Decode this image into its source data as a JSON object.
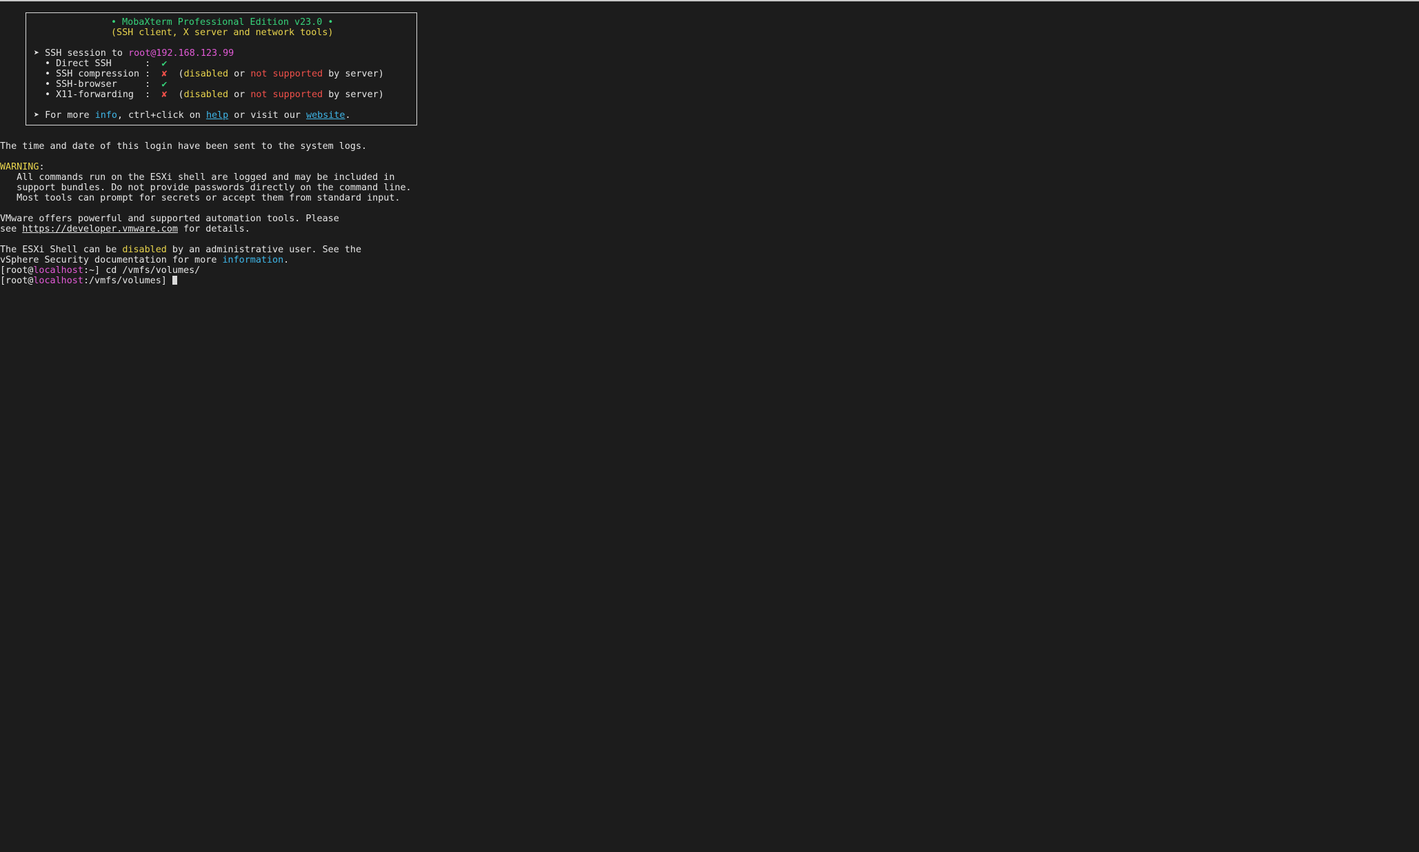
{
  "banner": {
    "title_bullet_left": "•",
    "title": "MobaXterm Professional Edition v23.0",
    "title_bullet_right": "•",
    "subtitle": "(SSH client, X server and network tools)",
    "session_arrow": "➤",
    "session_prefix": "SSH session to",
    "session_target": "root@192.168.123.99",
    "items": [
      {
        "bullet": "•",
        "label": "Direct SSH      :",
        "mark": "✔",
        "status": "ok"
      },
      {
        "bullet": "•",
        "label": "SSH compression :",
        "mark": "✘",
        "status": "fail",
        "note_open": "(",
        "note_disabled": "disabled",
        "note_or": "or",
        "note_not_supported": "not supported",
        "note_by": "by server)"
      },
      {
        "bullet": "•",
        "label": "SSH-browser     :",
        "mark": "✔",
        "status": "ok"
      },
      {
        "bullet": "•",
        "label": "X11-forwarding  :",
        "mark": "✘",
        "status": "fail",
        "note_open": "(",
        "note_disabled": "disabled",
        "note_or": "or",
        "note_not_supported": "not supported",
        "note_by": "by server)"
      }
    ],
    "more_arrow": "➤",
    "more_prefix": "For more",
    "more_info": "info",
    "more_mid": ", ctrl+click on",
    "more_help": "help",
    "more_visit": "or visit our",
    "more_website": "website",
    "more_end": "."
  },
  "output": {
    "login_notice": "The time and date of this login have been sent to the system logs.",
    "warning_label": "WARNING",
    "warning_colon": ":",
    "warning_lines": [
      "   All commands run on the ESXi shell are logged and may be included in",
      "   support bundles. Do not provide passwords directly on the command line.",
      "   Most tools can prompt for secrets or accept them from standard input."
    ],
    "vmware_line1": "VMware offers powerful and supported automation tools. Please",
    "vmware_see": "see ",
    "vmware_url": "https://developer.vmware.com",
    "vmware_details": " for details.",
    "esxi_prefix": "The ESXi Shell can be ",
    "esxi_disabled": "disabled",
    "esxi_suffix": " by an administrative user. See the",
    "vsphere_prefix": "vSphere Security documentation for more ",
    "vsphere_information": "information",
    "vsphere_end": "."
  },
  "prompts": [
    {
      "open": "[root@",
      "host": "localhost",
      "path": ":~] ",
      "command": "cd /vmfs/volumes/"
    },
    {
      "open": "[root@",
      "host": "localhost",
      "path": ":/vmfs/volumes] ",
      "command": ""
    }
  ],
  "colors": {
    "background": "#1c1c1c",
    "text": "#e6e6e6",
    "green": "#36d27a",
    "yellow": "#e8d44d",
    "magenta": "#e25ad6",
    "red": "#f0504a",
    "cyan": "#3fb6e8"
  }
}
